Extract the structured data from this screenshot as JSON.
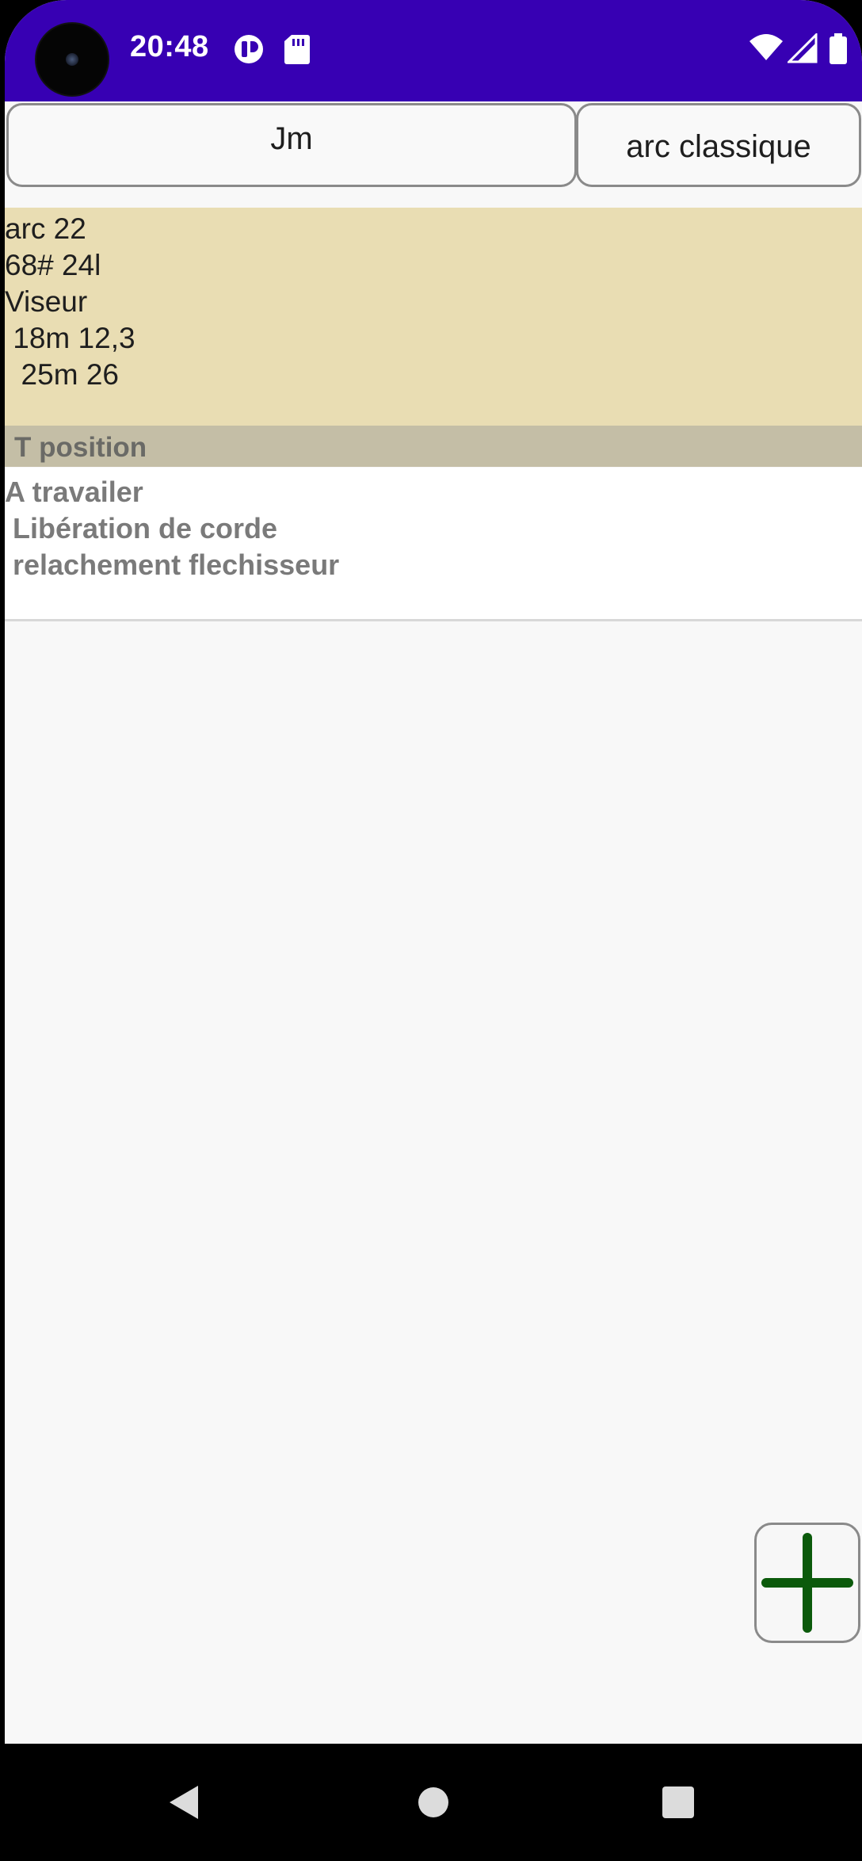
{
  "status_bar": {
    "time": "20:48",
    "icons": [
      "camera-cutout",
      "notification-icon",
      "sd-card-icon",
      "wifi-icon",
      "cellular-signal-icon",
      "battery-icon"
    ],
    "background": "#3700b3"
  },
  "toolbar": {
    "user": "Jm",
    "bow_type": "arc classique"
  },
  "note": {
    "lines": [
      "arc 22",
      "68# 24l",
      "Viseur",
      " 18m 12,3",
      "  25m 26"
    ],
    "background": "#e9ddb3"
  },
  "section": {
    "title": "T position",
    "background": "#c4bea6"
  },
  "work_item": {
    "lines": [
      "A travailer",
      " Libération de corde",
      " relachement flechisseur"
    ]
  },
  "add_button": {
    "icon": "plus-icon",
    "icon_color": "#0b5a0b"
  },
  "nav_bar": {
    "icons": [
      "back-icon",
      "home-icon",
      "recents-icon"
    ]
  }
}
